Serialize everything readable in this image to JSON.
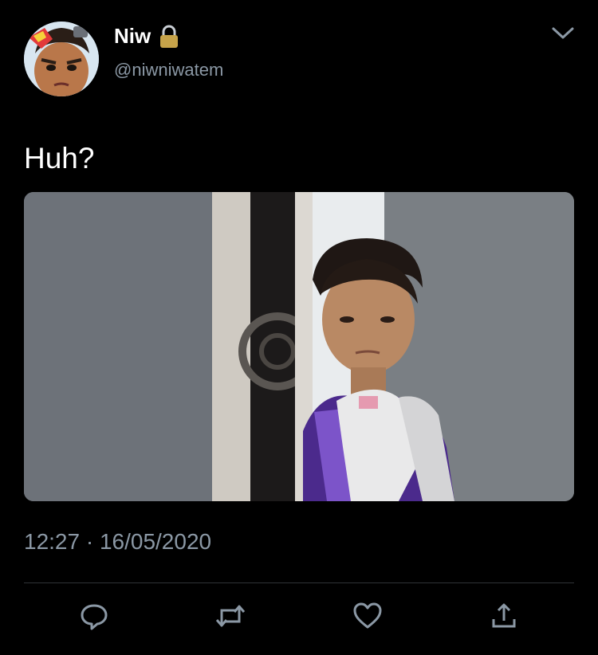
{
  "user": {
    "display_name": "Niw",
    "handle": "@niwniwatem",
    "verified_lock": "lock-icon",
    "avatar_icon": "avatar"
  },
  "tweet": {
    "text": "Huh?",
    "timestamp": "12:27 · 16/05/2020",
    "media": "tweet-photo"
  },
  "actions": [
    {
      "icon": "reply-icon"
    },
    {
      "icon": "retweet-icon"
    },
    {
      "icon": "like-icon"
    },
    {
      "icon": "share-icon"
    }
  ],
  "colors": {
    "background": "#000000",
    "text": "#ffffff",
    "secondary": "#8b98a5",
    "divider": "#2f3336",
    "lock": "#c6a34a"
  }
}
